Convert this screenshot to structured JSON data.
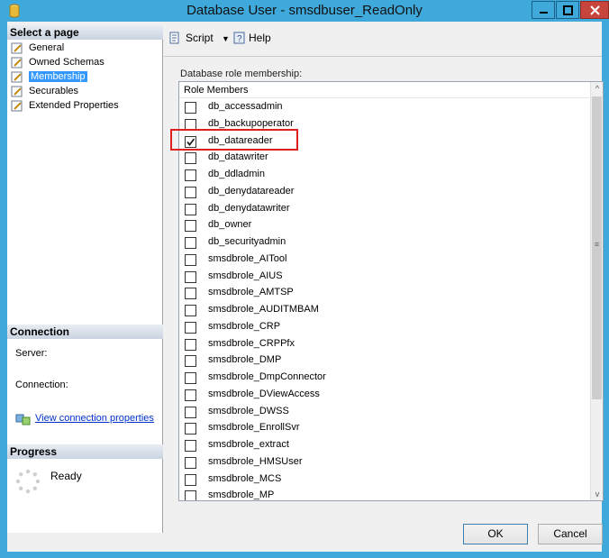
{
  "window": {
    "title": "Database User - smsdbuser_ReadOnly",
    "icon": "database-cylinder-icon"
  },
  "left": {
    "select_header": "Select a page",
    "pages": [
      {
        "label": "General",
        "icon": "page-wrench-icon",
        "selected": false
      },
      {
        "label": "Owned Schemas",
        "icon": "page-wrench-icon",
        "selected": false
      },
      {
        "label": "Membership",
        "icon": "page-wrench-icon",
        "selected": true
      },
      {
        "label": "Securables",
        "icon": "page-wrench-icon",
        "selected": false
      },
      {
        "label": "Extended Properties",
        "icon": "page-wrench-icon",
        "selected": false
      }
    ],
    "connection_header": "Connection",
    "server_label": "Server:",
    "connection_label": "Connection:",
    "view_connection_link": "View connection properties",
    "progress_header": "Progress",
    "progress_status": "Ready"
  },
  "toolbar": {
    "script_label": "Script",
    "help_label": "Help"
  },
  "membership": {
    "label": "Database role membership:",
    "column_header": "Role Members",
    "roles": [
      {
        "name": "db_accessadmin",
        "checked": false
      },
      {
        "name": "db_backupoperator",
        "checked": false
      },
      {
        "name": "db_datareader",
        "checked": true
      },
      {
        "name": "db_datawriter",
        "checked": false
      },
      {
        "name": "db_ddladmin",
        "checked": false
      },
      {
        "name": "db_denydatareader",
        "checked": false
      },
      {
        "name": "db_denydatawriter",
        "checked": false
      },
      {
        "name": "db_owner",
        "checked": false
      },
      {
        "name": "db_securityadmin",
        "checked": false
      },
      {
        "name": "smsdbrole_AITool",
        "checked": false
      },
      {
        "name": "smsdbrole_AIUS",
        "checked": false
      },
      {
        "name": "smsdbrole_AMTSP",
        "checked": false
      },
      {
        "name": "smsdbrole_AUDITMBAM",
        "checked": false
      },
      {
        "name": "smsdbrole_CRP",
        "checked": false
      },
      {
        "name": "smsdbrole_CRPPfx",
        "checked": false
      },
      {
        "name": "smsdbrole_DMP",
        "checked": false
      },
      {
        "name": "smsdbrole_DmpConnector",
        "checked": false
      },
      {
        "name": "smsdbrole_DViewAccess",
        "checked": false
      },
      {
        "name": "smsdbrole_DWSS",
        "checked": false
      },
      {
        "name": "smsdbrole_EnrollSvr",
        "checked": false
      },
      {
        "name": "smsdbrole_extract",
        "checked": false
      },
      {
        "name": "smsdbrole_HMSUser",
        "checked": false
      },
      {
        "name": "smsdbrole_MCS",
        "checked": false
      },
      {
        "name": "smsdbrole_MP",
        "checked": false
      }
    ],
    "highlight_color": "#e0201f"
  },
  "buttons": {
    "ok": "OK",
    "cancel": "Cancel"
  },
  "colors": {
    "titlebar": "#3fa9dc",
    "selection": "#3399ff",
    "close_button": "#c7453c"
  }
}
